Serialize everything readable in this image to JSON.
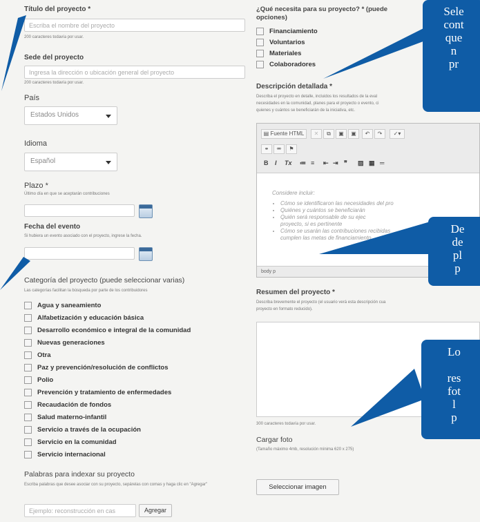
{
  "left": {
    "title": {
      "label": "Título del proyecto *",
      "placeholder": "Escriba el nombre del proyecto",
      "counter": "200 caracteres todavía por usar."
    },
    "location": {
      "label": "Sede del proyecto",
      "placeholder": "Ingresa la dirección o ubicación general del proyecto",
      "counter": "200 caracteres todavía por usar."
    },
    "country": {
      "label": "País",
      "value": "Estados Unidos"
    },
    "language": {
      "label": "Idioma",
      "value": "Español"
    },
    "deadline": {
      "label": "Plazo *",
      "help": "Último día en que se aceptarán contribuciones"
    },
    "event_date": {
      "label": "Fecha del evento",
      "help": "Si hubiera un evento asociado con el proyecto, ingrese la fecha."
    },
    "category": {
      "label": "Categoría del proyecto (puede seleccionar varias)",
      "help": "Las categorías facilitan la búsqueda por parte de los contribuidores",
      "options": [
        "Agua y saneamiento",
        "Alfabetización y educación básica",
        "Desarrollo económico e integral de la comunidad",
        "Nuevas generaciones",
        "Otra",
        "Paz y prevención/resolución de conflictos",
        "Polio",
        "Prevención y tratamiento de enfermedades",
        "Recaudación de fondos",
        "Salud materno-infantil",
        "Servicio a través de la ocupación",
        "Servicio en la comunidad",
        "Servicio internacional"
      ]
    },
    "keywords": {
      "label": "Palabras para indexar su proyecto",
      "help": "Escriba palabras que desee asociar con su proyecto, sepárelas con comas y haga clic en \"Agregar\"",
      "placeholder": "Ejemplo: reconstrucción en cas",
      "button": "Agregar"
    }
  },
  "right": {
    "needs": {
      "label": "¿Qué necesita para su proyecto? * (puede",
      "label2": "opciones)",
      "options": [
        "Financiamiento",
        "Voluntarios",
        "Materiales",
        "Colaboradores"
      ]
    },
    "description": {
      "label": "Descripción detallada *",
      "help1": "Describa el proyecto en detalle, incluidos los resultados de la eval",
      "help2": "necesidades en la comunidad, planes para el proyecto o evento, ci",
      "help3": "quienes y cuántos se beneficiarán de la iniciativa, etc.",
      "toolbar_source": "Fuente HTML",
      "toolbar_format": "Tx",
      "hint_title": "Considere incluir:",
      "hints": [
        "Cómo se identificaron las necesidades del pro",
        "Quiénes y cuántos se beneficiarán",
        "Quién será responsable de su ejec",
        "proyecto, si es pertinente",
        "Cómo se usarán las contribuciones recibidas",
        "cumplen las metas de financiamiento"
      ],
      "status": "body  p"
    },
    "summary": {
      "label": "Resumen del proyecto *",
      "help1": "Describa brevemente el proyecto (el usuario verá esta descripción cua",
      "help2": "proyecto en formato reducido).",
      "counter": "300 caracteres todavía por usar."
    },
    "photo": {
      "label": "Cargar foto",
      "help": "(Tamaño máximo 4mb, resolución mínima 620 x 275)",
      "button": "Seleccionar imagen"
    }
  },
  "callouts": {
    "top": [
      "Sele",
      "cont",
      "que",
      "n",
      "pr"
    ],
    "middle": [
      "De",
      "de",
      "pl",
      "p"
    ],
    "bottom": [
      "Lo",
      "",
      "res",
      "fot",
      "l",
      "p"
    ]
  },
  "colors": {
    "callout": "#0f5ca6",
    "background": "#f4f4f2"
  }
}
